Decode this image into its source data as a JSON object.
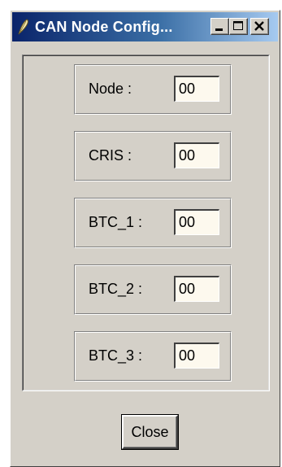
{
  "window": {
    "title": "CAN Node Config...",
    "icon": "quill-icon",
    "controls": {
      "minimize": "minimize-icon",
      "maximize": "maximize-icon",
      "close": "close-icon"
    }
  },
  "fields": [
    {
      "label": "Node :",
      "value": "00"
    },
    {
      "label": "CRIS :",
      "value": "00"
    },
    {
      "label": "BTC_1 :",
      "value": "00"
    },
    {
      "label": "BTC_2 :",
      "value": "00"
    },
    {
      "label": "BTC_3 :",
      "value": "00"
    }
  ],
  "footer": {
    "close_label": "Close"
  },
  "colors": {
    "title_bar_start": "#0a246a",
    "title_bar_end": "#a6caf0",
    "window_face": "#d4d0c8",
    "input_background": "#fdf9ee"
  }
}
